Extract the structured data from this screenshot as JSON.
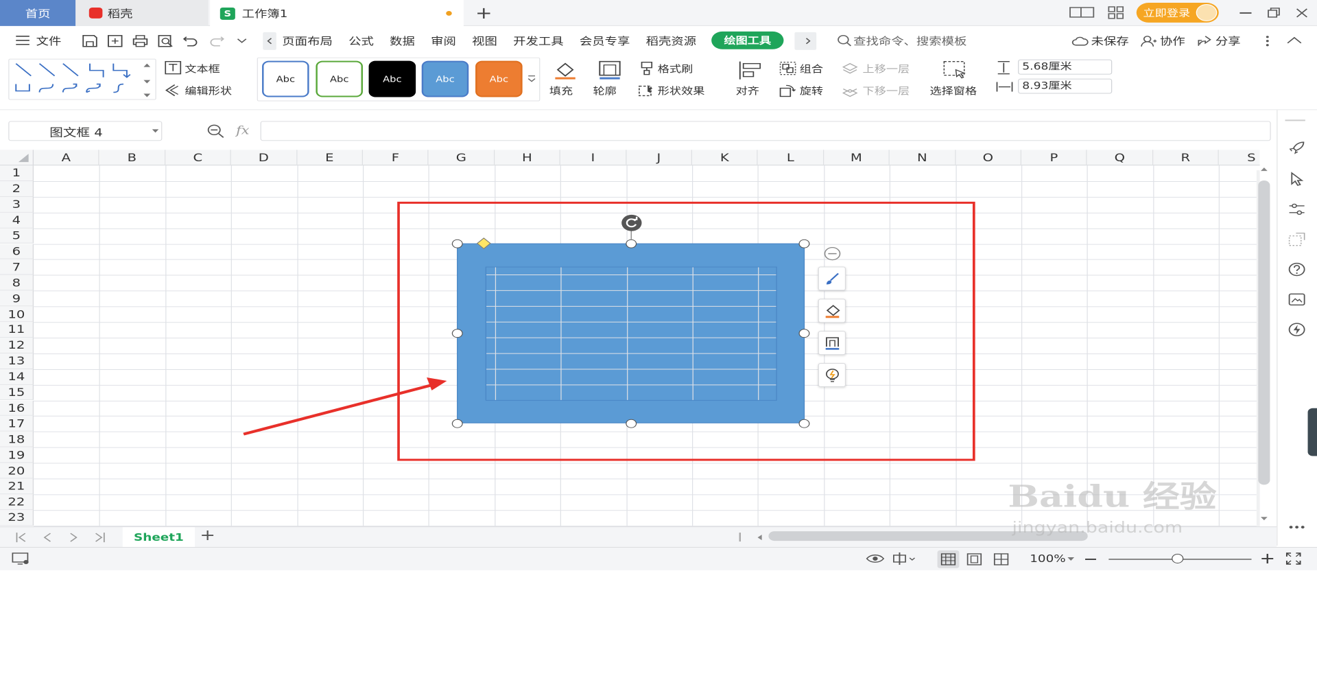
{
  "tabs": {
    "home": "首页",
    "daoke": "稻壳",
    "book": "工作簿1",
    "add": "+"
  },
  "login": "立即登录",
  "menu": {
    "file": "文件",
    "items": [
      "页面布局",
      "公式",
      "数据",
      "审阅",
      "视图",
      "开发工具",
      "会员专享",
      "稻壳资源"
    ],
    "draw_tools": "绘图工具",
    "search_placeholder": "查找命令、搜索模板",
    "unsaved": "未保存",
    "collab": "协作",
    "share": "分享"
  },
  "ribbon": {
    "textbox": "文本框",
    "edit_shape": "编辑形状",
    "styles": [
      {
        "label": "Abc",
        "border": "#4a7bc8",
        "bg": "#ffffff",
        "color": "#222"
      },
      {
        "label": "Abc",
        "border": "#5aa83a",
        "bg": "#ffffff",
        "color": "#222"
      },
      {
        "label": "Abc",
        "border": "#000000",
        "bg": "#000000",
        "color": "#ffffff"
      },
      {
        "label": "Abc",
        "border": "#4a7bc8",
        "bg": "#5b9bd5",
        "color": "#ffffff"
      },
      {
        "label": "Abc",
        "border": "#e07020",
        "bg": "#ed7d31",
        "color": "#ffffff"
      }
    ],
    "fill": "填充",
    "outline": "轮廓",
    "format_brush": "格式刷",
    "shape_effect": "形状效果",
    "align": "对齐",
    "group": "组合",
    "rotate": "旋转",
    "bring_forward": "上移一层",
    "send_backward": "下移一层",
    "select_pane": "选择窗格",
    "height": "5.68厘米",
    "width": "8.93厘米"
  },
  "formula": {
    "namebox": "图文框 4",
    "fx": "fx",
    "value": ""
  },
  "columns": [
    "A",
    "B",
    "C",
    "D",
    "E",
    "F",
    "G",
    "H",
    "I",
    "J",
    "K",
    "L",
    "M",
    "N",
    "O",
    "P",
    "Q",
    "R",
    "S"
  ],
  "rows": [
    "1",
    "2",
    "3",
    "4",
    "5",
    "6",
    "7",
    "8",
    "9",
    "10",
    "11",
    "12",
    "13",
    "14",
    "15",
    "16",
    "17",
    "18",
    "19",
    "20",
    "21",
    "22",
    "23"
  ],
  "sheet": {
    "name": "Sheet1",
    "add": "+"
  },
  "status": {
    "zoom": "100%"
  },
  "colors": {
    "accent": "#1fa55a",
    "frame": "#5b9bd5",
    "annotation": "#e8302a"
  },
  "watermark": {
    "main": "Baidu 经验",
    "sub": "jingyan.baidu.com"
  }
}
